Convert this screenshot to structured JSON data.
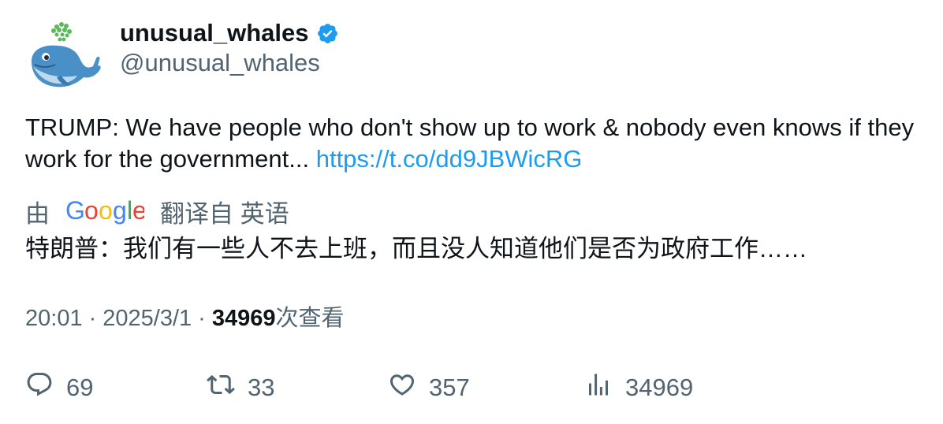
{
  "author": {
    "display_name": "unusual_whales",
    "handle": "@unusual_whales",
    "verified": true,
    "avatar_icon": "whale-avatar-icon"
  },
  "tweet": {
    "text": "TRUMP: We have people who don't show up to work & nobody even knows if they work for the government... ",
    "link": "https://t.co/dd9JBWicRG"
  },
  "translation": {
    "prefix": "由",
    "provider": "Google",
    "suffix": "翻译自 英语",
    "text": "特朗普：我们有一些人不去上班，而且没人知道他们是否为政府工作……"
  },
  "meta": {
    "time": "20:01",
    "separator": "·",
    "date": "2025/3/1",
    "views_count": "34969",
    "views_label": "次查看"
  },
  "actions": {
    "reply_count": "69",
    "retweet_count": "33",
    "like_count": "357",
    "views_count": "34969"
  },
  "colors": {
    "link": "#1d9bf0",
    "secondary_text": "#536471",
    "primary_text": "#0f1419",
    "verified_badge": "#1d9bf0"
  }
}
